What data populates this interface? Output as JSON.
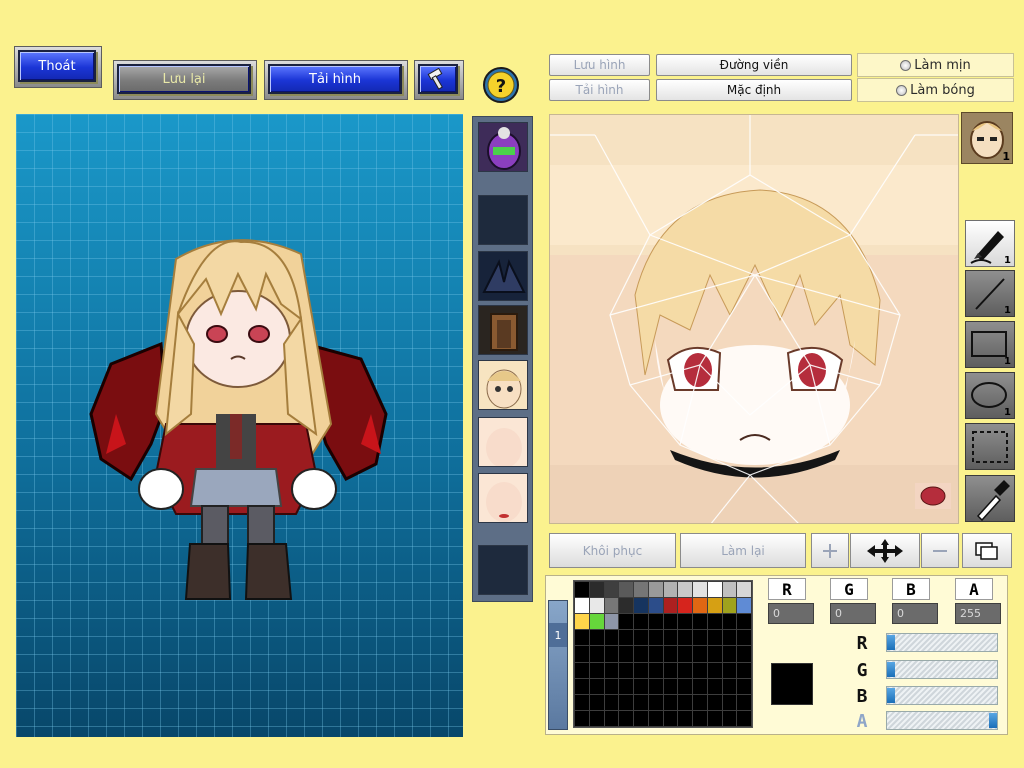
{
  "toolbar": {
    "exit_label": "Thoát",
    "save_label": "Lưu lại",
    "load_label": "Tải hình",
    "hammer_icon": "hammer-icon",
    "help_icon": "help-icon"
  },
  "editor_tabs": {
    "save_image": "Lưu hình",
    "load_image": "Tải hình",
    "outline": "Đường viền",
    "default": "Mặc định",
    "smooth": "Làm mịn",
    "shade": "Làm bóng"
  },
  "actions": {
    "restore": "Khôi phục",
    "redo": "Làm lại"
  },
  "layer": {
    "badge": "1"
  },
  "tools": [
    {
      "name": "pen-tool",
      "count": "1"
    },
    {
      "name": "line-tool",
      "count": "1"
    },
    {
      "name": "rectangle-tool",
      "count": "1"
    },
    {
      "name": "ellipse-tool",
      "count": "1"
    },
    {
      "name": "select-tool",
      "count": ""
    },
    {
      "name": "eyedropper-tool",
      "count": ""
    }
  ],
  "channels": {
    "r_label": "R",
    "g_label": "G",
    "b_label": "B",
    "a_label": "A",
    "r": "0",
    "g": "0",
    "b": "0",
    "a": "255"
  },
  "sliders": {
    "r": 0,
    "g": 0,
    "b": 0,
    "a": 255,
    "max": 255
  },
  "palette_tab": "1",
  "palette_colors": [
    "#000000",
    "#2b2b2b",
    "#3f3f3f",
    "#5a5a5a",
    "#767676",
    "#9a9a9a",
    "#b2b2b2",
    "#c9c9c9",
    "#e3e3e3",
    "#ffffff",
    "#c0c0c0",
    "#d7d7d7",
    "#ffffff",
    "#e8e8e8",
    "#777777",
    "#2c2c2c",
    "#16345f",
    "#2c4d8a",
    "#ad2020",
    "#d6241d",
    "#e06713",
    "#d6a014",
    "#9fa21d",
    "#5f8bd5",
    "#ffd54a",
    "#66d63b",
    "#8e96a8"
  ],
  "current_color": "#000000"
}
